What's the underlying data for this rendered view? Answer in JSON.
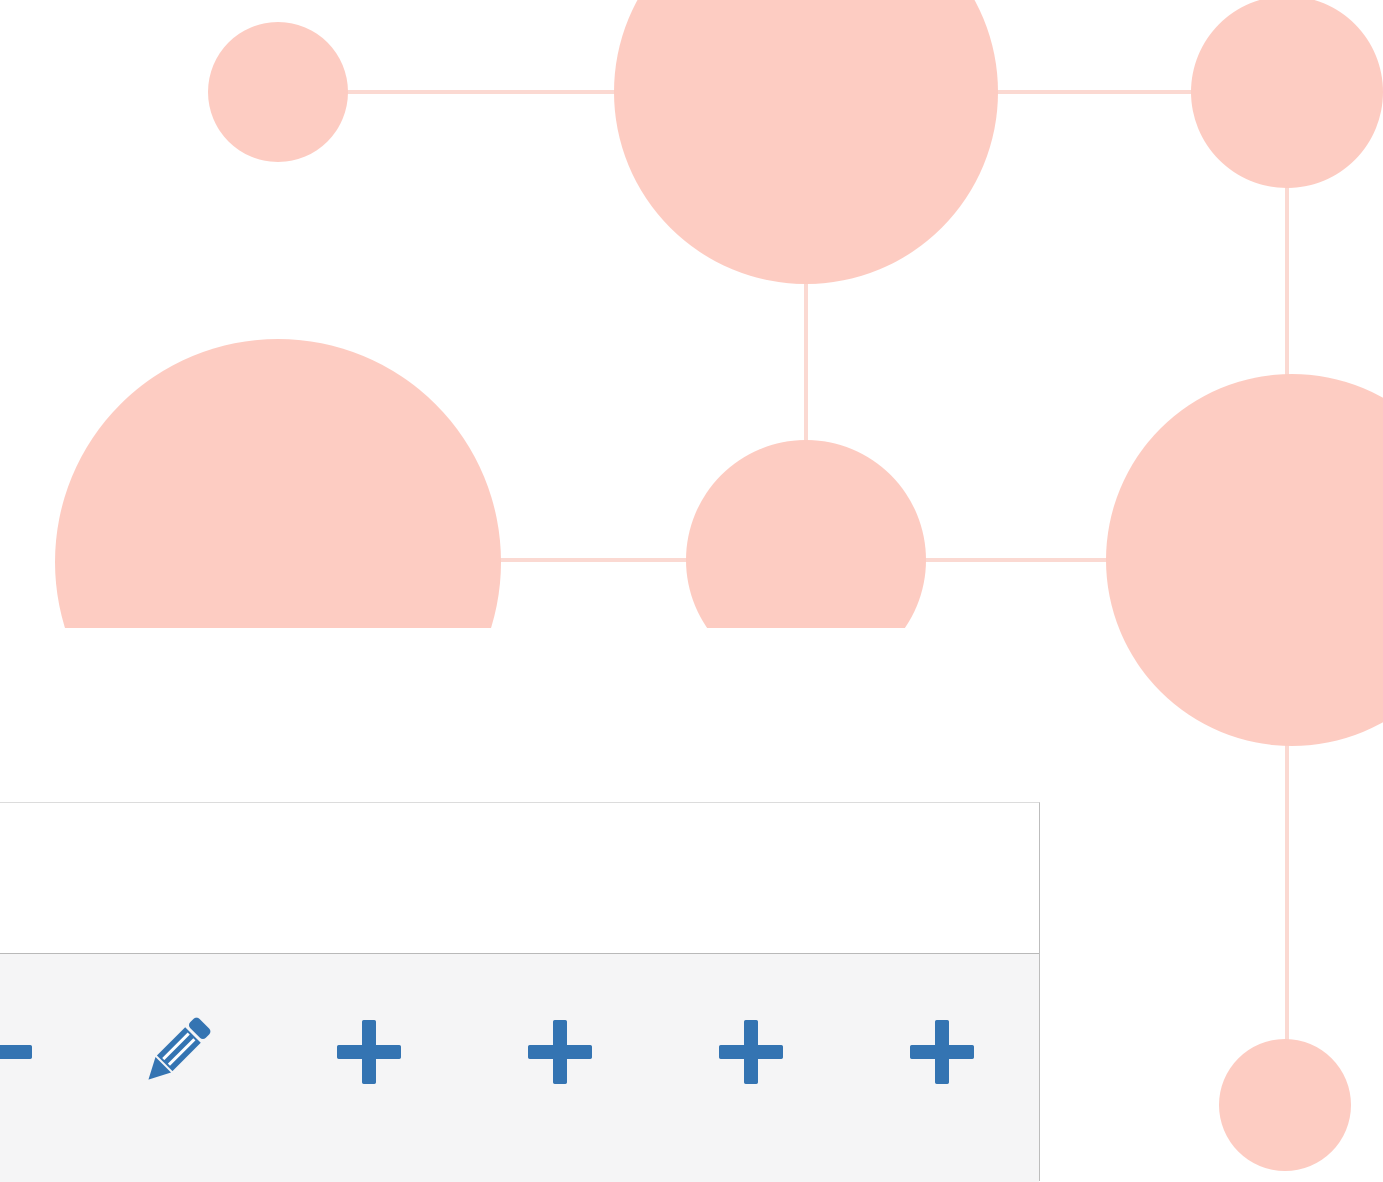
{
  "colors": {
    "background": "#ffffff",
    "node": "#fdccc2",
    "link": "#fbd9d2",
    "panel_header": "#ffffff",
    "panel_toolbar": "#f5f5f6",
    "panel_border": "#b9b9b9",
    "icon": "#3474b2"
  },
  "toolbar": {
    "buttons": [
      {
        "icon": "minus-icon"
      },
      {
        "icon": "pencil-icon"
      },
      {
        "icon": "plus-icon"
      },
      {
        "icon": "plus-icon"
      },
      {
        "icon": "plus-icon"
      },
      {
        "icon": "plus-icon"
      }
    ]
  }
}
